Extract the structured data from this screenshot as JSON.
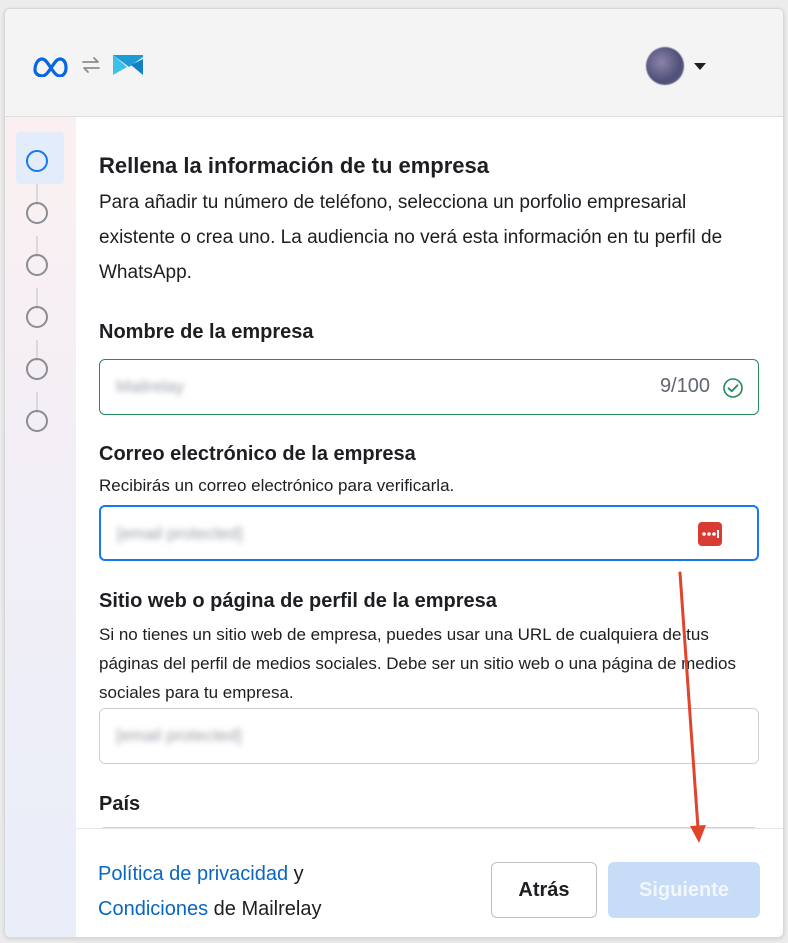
{
  "header": {
    "logos": [
      "meta-logo",
      "swap-icon",
      "mailrelay-logo"
    ],
    "account_menu": "chevron-down-icon"
  },
  "stepper": {
    "steps": 6,
    "active_step": 1
  },
  "form": {
    "title": "Rellena la información de tu empresa",
    "description": "Para añadir tu número de teléfono, selecciona un porfolio empresarial existente o crea uno. La audiencia no verá esta información en tu perfil de WhatsApp.",
    "company_name": {
      "label": "Nombre de la empresa",
      "value": "Mailrelay",
      "counter": "9/100"
    },
    "email": {
      "label": "Correo electrónico de la empresa",
      "help": "Recibirás un correo electrónico para verificarla.",
      "value": "[email protected]"
    },
    "website": {
      "label": "Sitio web o página de perfil de la empresa",
      "help": "Si no tienes un sitio web de empresa, puedes usar una URL de cualquiera de tus páginas del perfil de medios sociales. Debe ser un sitio web o una página de medios sociales para tu empresa.",
      "value": "[email protected]"
    },
    "country": {
      "label": "País"
    }
  },
  "footer": {
    "privacy_link": "Política de privacidad",
    "and": " y",
    "terms_link": "Condiciones",
    "of_company": " de Mailrelay",
    "back_button": "Atrás",
    "next_button": "Siguiente"
  },
  "colors": {
    "accent": "#1877f2",
    "link": "#0a66c2",
    "valid": "#258a5a",
    "annotation_arrow": "#e0452c"
  }
}
